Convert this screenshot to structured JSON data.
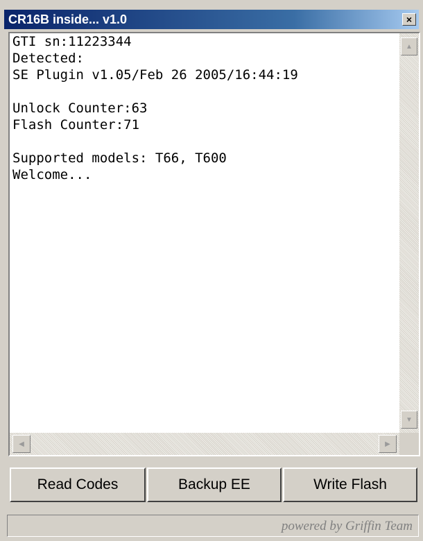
{
  "window": {
    "title": "CR16B inside... v1.0",
    "close_glyph": "×"
  },
  "log": {
    "lines": [
      "GTI sn:11223344",
      "Detected:",
      "SE Plugin v1.05/Feb 26 2005/16:44:19",
      "",
      "Unlock Counter:63",
      "Flash Counter:71",
      "",
      "Supported models: T66, T600",
      "Welcome..."
    ]
  },
  "scrollbars": {
    "up_icon": "arrow-up-icon",
    "down_icon": "arrow-down-icon",
    "left_icon": "arrow-left-icon",
    "right_icon": "arrow-right-icon"
  },
  "buttons": {
    "read_codes": "Read Codes",
    "backup_ee": "Backup EE",
    "write_flash": "Write Flash"
  },
  "status": {
    "text": "powered by Griffin Team"
  },
  "colors": {
    "titlebar_start": "#0a246a",
    "titlebar_end": "#a6caf0",
    "face": "#d4d0c8",
    "log_background": "#ffffff"
  }
}
